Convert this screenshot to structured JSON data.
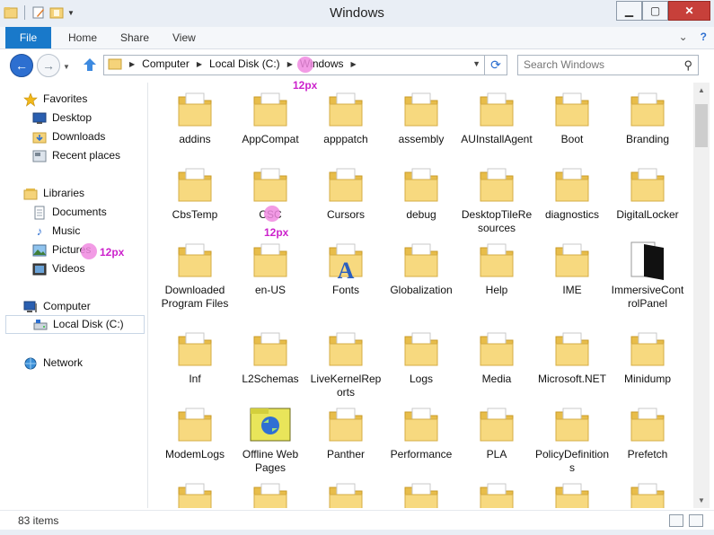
{
  "window": {
    "title": "Windows"
  },
  "ribbon": {
    "tabs": [
      "File",
      "Home",
      "Share",
      "View"
    ]
  },
  "address": {
    "crumbs": [
      "Computer",
      "Local Disk (C:)",
      "Windows"
    ]
  },
  "search": {
    "placeholder": "Search Windows"
  },
  "annotations": [
    "12px",
    "12px",
    "12px"
  ],
  "sidebar": {
    "favorites": {
      "label": "Favorites",
      "items": [
        "Desktop",
        "Downloads",
        "Recent places"
      ]
    },
    "libraries": {
      "label": "Libraries",
      "items": [
        "Documents",
        "Music",
        "Pictures",
        "Videos"
      ]
    },
    "computer": {
      "label": "Computer",
      "items": [
        "Local Disk (C:)"
      ]
    },
    "network": {
      "label": "Network"
    }
  },
  "folders": [
    {
      "name": "addins",
      "icon": "folder-icon"
    },
    {
      "name": "AppCompat",
      "icon": "folder-icon"
    },
    {
      "name": "apppatch",
      "icon": "folder-icon"
    },
    {
      "name": "assembly",
      "icon": "folder-icon"
    },
    {
      "name": "AUInstallAgent",
      "icon": "folder-icon"
    },
    {
      "name": "Boot",
      "icon": "folder-icon"
    },
    {
      "name": "Branding",
      "icon": "folder-icon"
    },
    {
      "name": "CbsTemp",
      "icon": "folder-icon"
    },
    {
      "name": "CSC",
      "icon": "folder-icon"
    },
    {
      "name": "Cursors",
      "icon": "folder-icon"
    },
    {
      "name": "debug",
      "icon": "folder-icon"
    },
    {
      "name": "DesktopTileResources",
      "icon": "folder-icon"
    },
    {
      "name": "diagnostics",
      "icon": "folder-icon"
    },
    {
      "name": "DigitalLocker",
      "icon": "folder-icon"
    },
    {
      "name": "Downloaded Program Files",
      "icon": "folder-icon"
    },
    {
      "name": "en-US",
      "icon": "folder-icon"
    },
    {
      "name": "Fonts",
      "icon": "fonts-folder-icon"
    },
    {
      "name": "Globalization",
      "icon": "folder-icon"
    },
    {
      "name": "Help",
      "icon": "folder-icon"
    },
    {
      "name": "IME",
      "icon": "folder-icon"
    },
    {
      "name": "ImmersiveControlPanel",
      "icon": "dark-folder-icon"
    },
    {
      "name": "Inf",
      "icon": "folder-icon"
    },
    {
      "name": "L2Schemas",
      "icon": "folder-icon"
    },
    {
      "name": "LiveKernelReports",
      "icon": "folder-icon"
    },
    {
      "name": "Logs",
      "icon": "folder-icon"
    },
    {
      "name": "Media",
      "icon": "folder-icon"
    },
    {
      "name": "Microsoft.NET",
      "icon": "folder-icon"
    },
    {
      "name": "Minidump",
      "icon": "folder-icon"
    },
    {
      "name": "ModemLogs",
      "icon": "folder-icon"
    },
    {
      "name": "Offline Web Pages",
      "icon": "offline-pages-icon"
    },
    {
      "name": "Panther",
      "icon": "folder-icon"
    },
    {
      "name": "Performance",
      "icon": "folder-icon"
    },
    {
      "name": "PLA",
      "icon": "folder-icon"
    },
    {
      "name": "PolicyDefinitions",
      "icon": "folder-icon"
    },
    {
      "name": "Prefetch",
      "icon": "folder-icon"
    },
    {
      "name": "",
      "icon": "folder-icon"
    },
    {
      "name": "",
      "icon": "folder-icon"
    },
    {
      "name": "",
      "icon": "folder-icon"
    },
    {
      "name": "",
      "icon": "folder-icon"
    },
    {
      "name": "",
      "icon": "folder-icon"
    },
    {
      "name": "",
      "icon": "folder-icon"
    },
    {
      "name": "",
      "icon": "folder-icon"
    }
  ],
  "status": {
    "item_count": "83 items"
  },
  "colors": {
    "accent": "#1979ca",
    "folder": "#f5d37a",
    "annotation": "#cc22cc"
  }
}
